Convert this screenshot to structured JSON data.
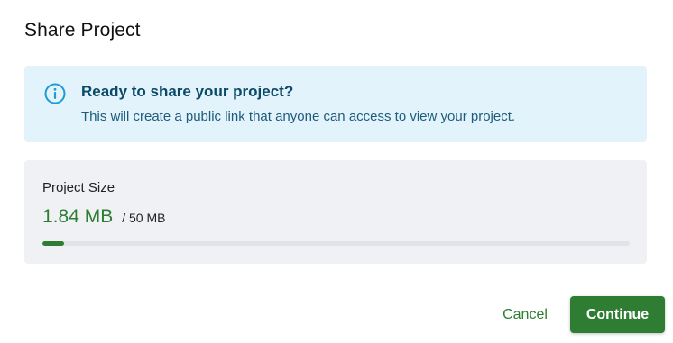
{
  "dialog": {
    "title": "Share Project"
  },
  "info": {
    "icon": "info-icon",
    "heading": "Ready to share your project?",
    "text": "This will create a public link that anyone can access to view your project."
  },
  "project_size": {
    "label": "Project Size",
    "used": "1.84 MB",
    "limit": "/ 50 MB",
    "used_fraction": 0.0368,
    "accent_color": "#2e7d32"
  },
  "actions": {
    "cancel_label": "Cancel",
    "continue_label": "Continue"
  },
  "colors": {
    "primary": "#2e7d32",
    "info_background": "#e3f3fb",
    "info_icon": "#1e9ad6",
    "panel_background": "#f0f1f5"
  }
}
